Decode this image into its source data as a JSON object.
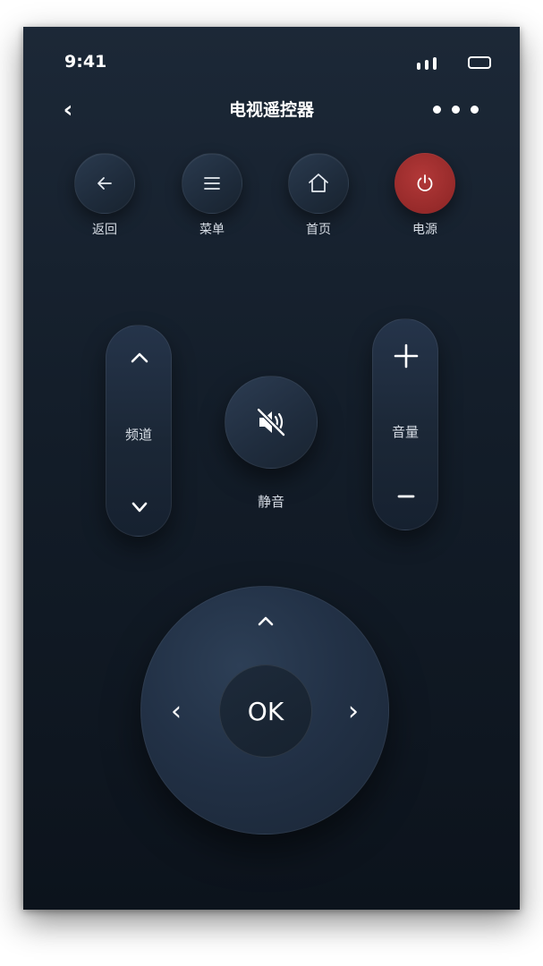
{
  "status_bar": {
    "time": "9:41"
  },
  "nav": {
    "title": "电视遥控器",
    "back_glyph": "‹"
  },
  "top_buttons": [
    {
      "id": "back",
      "label": "返回",
      "icon": "arrow-left-icon"
    },
    {
      "id": "menu",
      "label": "菜单",
      "icon": "menu-icon"
    },
    {
      "id": "home",
      "label": "首页",
      "icon": "home-icon"
    },
    {
      "id": "power",
      "label": "电源",
      "icon": "power-icon"
    }
  ],
  "channel": {
    "label": "频道",
    "up_icon": "chevron-up-icon",
    "down_icon": "chevron-down-icon"
  },
  "volume": {
    "label": "音量",
    "up_icon": "plus-icon",
    "down_icon": "minus-icon"
  },
  "mute": {
    "label": "静音",
    "icon": "speaker-muted-icon"
  },
  "dpad": {
    "ok_label": "OK",
    "left_glyph": "‹",
    "right_glyph": "›",
    "up_icon": "chevron-up-icon"
  },
  "colors": {
    "background_top": "#1c2837",
    "background_bottom": "#0c131c",
    "button": "#223146",
    "power_accent": "#9e2c2c",
    "text": "#ffffff",
    "label_text": "#d8dee6"
  }
}
